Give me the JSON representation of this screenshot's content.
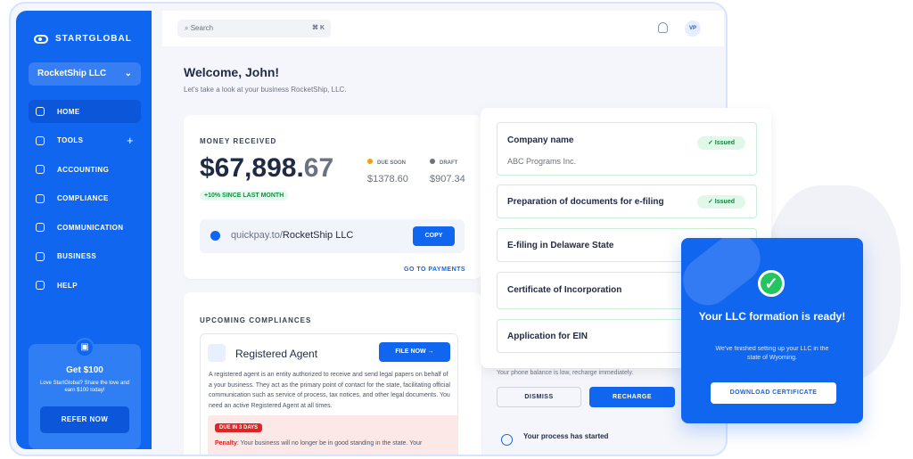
{
  "brand": "STARTGLOBAL",
  "company": "RocketShip LLC",
  "search": {
    "placeholder": "Search",
    "shortcut": "⌘ K"
  },
  "user_initials": "VP",
  "nav": [
    {
      "label": "HOME"
    },
    {
      "label": "TOOLS"
    },
    {
      "label": "ACCOUNTING"
    },
    {
      "label": "COMPLIANCE"
    },
    {
      "label": "COMMUNICATION"
    },
    {
      "label": "BUSINESS"
    },
    {
      "label": "HELP"
    }
  ],
  "promo": {
    "title": "Get $100",
    "text": "Love StartGlobal? Share the love and earn $100 today!",
    "button": "REFER NOW"
  },
  "welcome": {
    "title": "Welcome, John!",
    "subtitle": "Let's take a look at your business RocketShip, LLC."
  },
  "money": {
    "caption": "MONEY RECEIVED",
    "amount_main": "$67,898.",
    "amount_cents": "67",
    "growth": "+10% SINCE LAST MONTH",
    "due_soon": {
      "label": "DUE SOON",
      "main": "$1378.",
      "cents": "60"
    },
    "draft": {
      "label": "DRAFT",
      "main": "$907.",
      "cents": "34"
    },
    "quick_prefix": "quickpay.to/",
    "quick_name": "RocketShip LLC",
    "copy": "COPY",
    "go": "GO TO PAYMENTS"
  },
  "compliance": {
    "caption": "UPCOMING COMPLIANCES",
    "title": "Registered Agent",
    "button": "FILE NOW →",
    "description": "A registered agent is an entity authorized to receive and send legal papers on behalf of a your business. They act as the primary point of contact for the state, facilitating official communication such as service of process, tax notices, and other legal documents. You need an active Registered Agent at all times.",
    "badge": "DUE IN 3 DAYS",
    "penalty_label": "Penalty",
    "penalty_text": ": Your business will no longer be in good standing in the state. Your"
  },
  "steps": [
    {
      "title": "Company name",
      "status": "✓ Issued",
      "detail": "ABC Programs Inc."
    },
    {
      "title": "Preparation of documents for e-filing",
      "status": "✓ Issued"
    },
    {
      "title": "E-filing in Delaware State"
    },
    {
      "title": "Certificate of Incorporation"
    },
    {
      "title": "Application for EIN"
    }
  ],
  "phone": {
    "text": "Your phone balance is low, recharge immediately.",
    "dismiss": "DISMISS",
    "recharge": "RECHARGE",
    "process": "Your process has started"
  },
  "ready": {
    "title": "Your LLC formation is ready!",
    "text": "We've finished setting up your LLC in the state of Wyoming.",
    "button": "DOWNLOAD CERTIFICATE"
  },
  "colors": {
    "primary": "#1166f0",
    "success": "#22c55e",
    "danger": "#e02424"
  }
}
